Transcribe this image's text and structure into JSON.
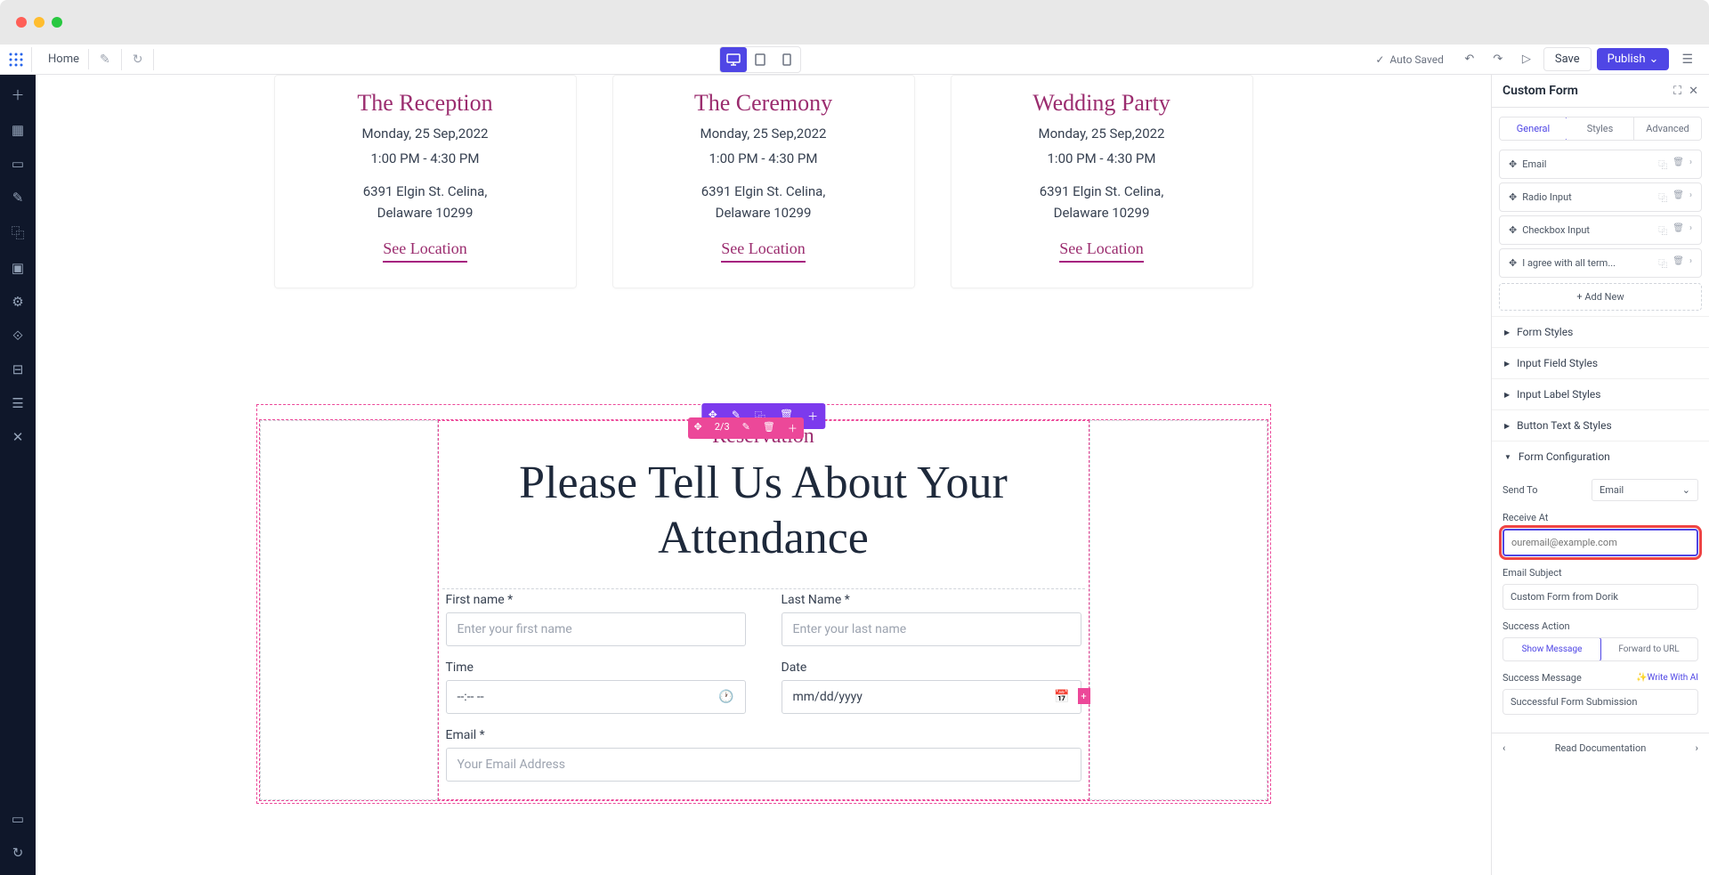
{
  "topbar": {
    "home": "Home",
    "autoSaved": "Auto Saved",
    "save": "Save",
    "publish": "Publish"
  },
  "events": [
    {
      "title": "The Reception",
      "date": "Monday, 25 Sep,2022",
      "time": "1:00 PM - 4:30 PM",
      "addr1": "6391 Elgin St. Celina,",
      "addr2": "Delaware 10299",
      "link": "See Location"
    },
    {
      "title": "The Ceremony",
      "date": "Monday, 25 Sep,2022",
      "time": "1:00 PM - 4:30 PM",
      "addr1": "6391 Elgin St. Celina,",
      "addr2": "Delaware 10299",
      "link": "See Location"
    },
    {
      "title": "Wedding Party",
      "date": "Monday, 25 Sep,2022",
      "time": "1:00 PM - 4:30 PM",
      "addr1": "6391 Elgin St. Celina,",
      "addr2": "Delaware 10299",
      "link": "See Location"
    }
  ],
  "colToolbar": "2/3",
  "reservation": {
    "tag": "Reservation",
    "heading": "Please Tell Us About Your Attendance",
    "fields": {
      "firstName": {
        "label": "First name *",
        "placeholder": "Enter your first name"
      },
      "lastName": {
        "label": "Last Name *",
        "placeholder": "Enter your last name"
      },
      "time": {
        "label": "Time",
        "value": "--:-- --"
      },
      "date": {
        "label": "Date",
        "value": "mm/dd/yyyy"
      },
      "email": {
        "label": "Email *",
        "placeholder": "Your Email Address"
      }
    }
  },
  "panel": {
    "title": "Custom Form",
    "tabs": {
      "general": "General",
      "styles": "Styles",
      "advanced": "Advanced"
    },
    "fieldRows": [
      "Email",
      "Radio Input",
      "Checkbox Input",
      "I agree with all term..."
    ],
    "addNew": "+ Add New",
    "accordion": [
      "Form Styles",
      "Input Field Styles",
      "Input Label Styles",
      "Button Text & Styles",
      "Form Configuration"
    ],
    "config": {
      "sendTo": {
        "label": "Send To",
        "value": "Email"
      },
      "receiveAt": {
        "label": "Receive At",
        "placeholder": "ouremail@example.com"
      },
      "emailSubject": {
        "label": "Email Subject",
        "value": "Custom Form from Dorik"
      },
      "successAction": {
        "label": "Success Action",
        "showMsg": "Show Message",
        "forward": "Forward to URL"
      },
      "successMessage": {
        "label": "Success Message",
        "writeAI": "✨Write With AI",
        "value": "Successful Form Submission"
      }
    },
    "docs": "Read Documentation"
  }
}
